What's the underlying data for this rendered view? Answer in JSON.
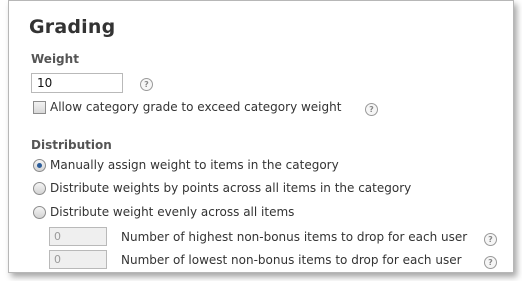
{
  "panel": {
    "title": "Grading"
  },
  "weight": {
    "label": "Weight",
    "value": "10",
    "help_icon": "help-icon"
  },
  "allow_exceed": {
    "label": "Allow category grade to exceed category weight",
    "checked": false,
    "help_icon": "help-icon"
  },
  "distribution": {
    "label": "Distribution",
    "options": [
      {
        "label": "Manually assign weight to items in the category",
        "selected": true
      },
      {
        "label": "Distribute weights by points across all items in the category",
        "selected": false
      },
      {
        "label": "Distribute weight evenly across all items",
        "selected": false
      }
    ],
    "drops": [
      {
        "value": "0",
        "label": "Number of highest non-bonus items to drop for each user",
        "help_icon": "help-icon"
      },
      {
        "value": "0",
        "label": "Number of lowest non-bonus items to drop for each user",
        "help_icon": "help-icon"
      }
    ]
  },
  "colors": {
    "radio_selected": "#2c5d9a",
    "disabled_input_bg": "#efefef"
  }
}
